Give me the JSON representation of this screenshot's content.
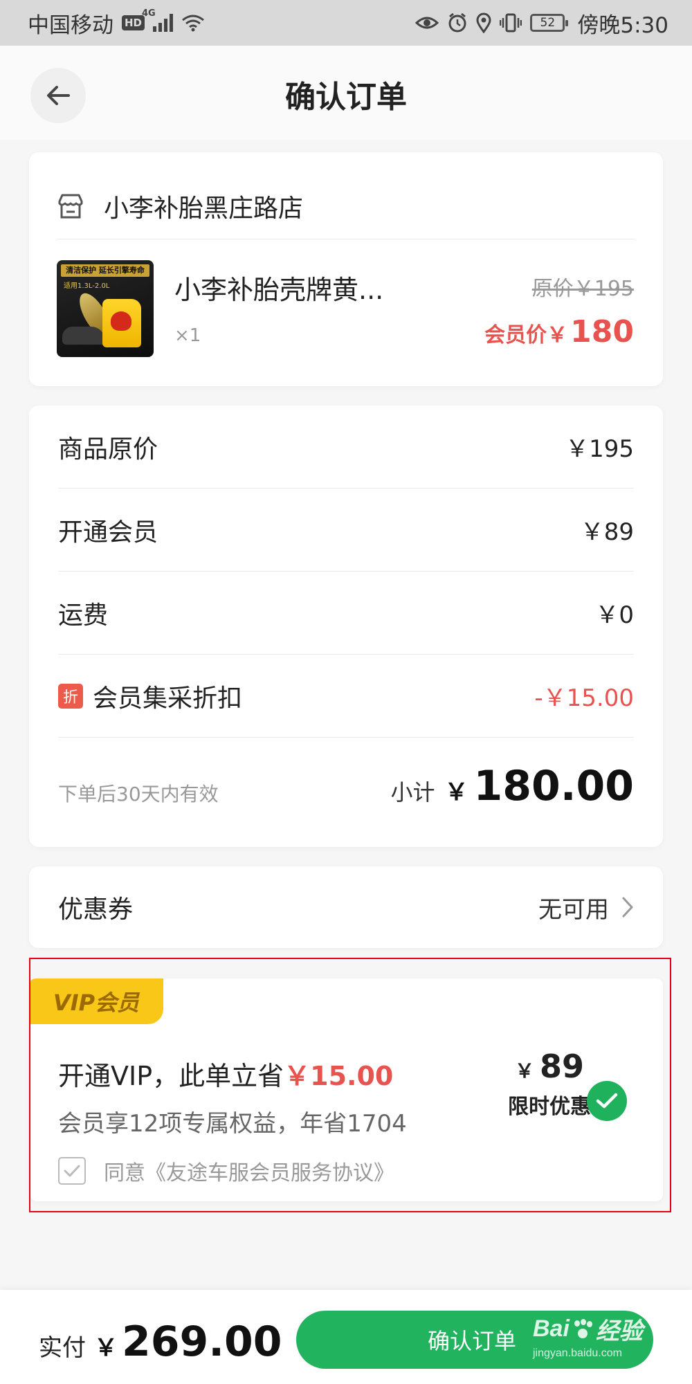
{
  "status_bar": {
    "carrier": "中国移动",
    "hd": "HD",
    "network": "4G",
    "battery": "52",
    "time": "傍晚5:30"
  },
  "header": {
    "title": "确认订单"
  },
  "store": {
    "name": "小李补胎黑庄路店",
    "product": {
      "name": "小李补胎壳牌黄...",
      "qty": "×1",
      "original_price": "原价￥195",
      "member_price_label": "会员价￥",
      "member_price": "180",
      "thumb_banner": "清洁保护 延长引擎寿命",
      "thumb_sub": "适用1.3L-2.0L"
    }
  },
  "fees": {
    "rows": [
      {
        "label": "商品原价",
        "value": "￥195"
      },
      {
        "label": "开通会员",
        "value": "￥89"
      },
      {
        "label": "运费",
        "value": "￥0"
      }
    ],
    "discount": {
      "tag": "折",
      "label": "会员集采折扣",
      "value": "-￥15.00"
    },
    "valid_note": "下单后30天内有效",
    "subtotal_label": "小计",
    "subtotal_currency": "￥",
    "subtotal_amount": "180.00"
  },
  "coupon": {
    "label": "优惠券",
    "status": "无可用"
  },
  "vip": {
    "badge": "VIP会员",
    "headline_prefix": "开通VIP，此单立省",
    "headline_save": "￥15.00",
    "subline": "会员享12项专属权益，年省1704",
    "agreement": "同意《友途车服会员服务协议》",
    "price_currency": "￥",
    "price_amount": "89",
    "limited_label": "限时优惠",
    "selected": true
  },
  "bottom_bar": {
    "pay_label": "实付",
    "pay_currency": "￥",
    "pay_amount": "269.00",
    "confirm_label": "确认订单"
  },
  "watermark": {
    "brand": "Bai",
    "brand_suffix": "经验",
    "url": "jingyan.baidu.com"
  },
  "colors": {
    "accent_green": "#22b35f",
    "price_red": "#e9534f",
    "vip_yellow": "#f9c718",
    "highlight_border": "#e60012"
  }
}
